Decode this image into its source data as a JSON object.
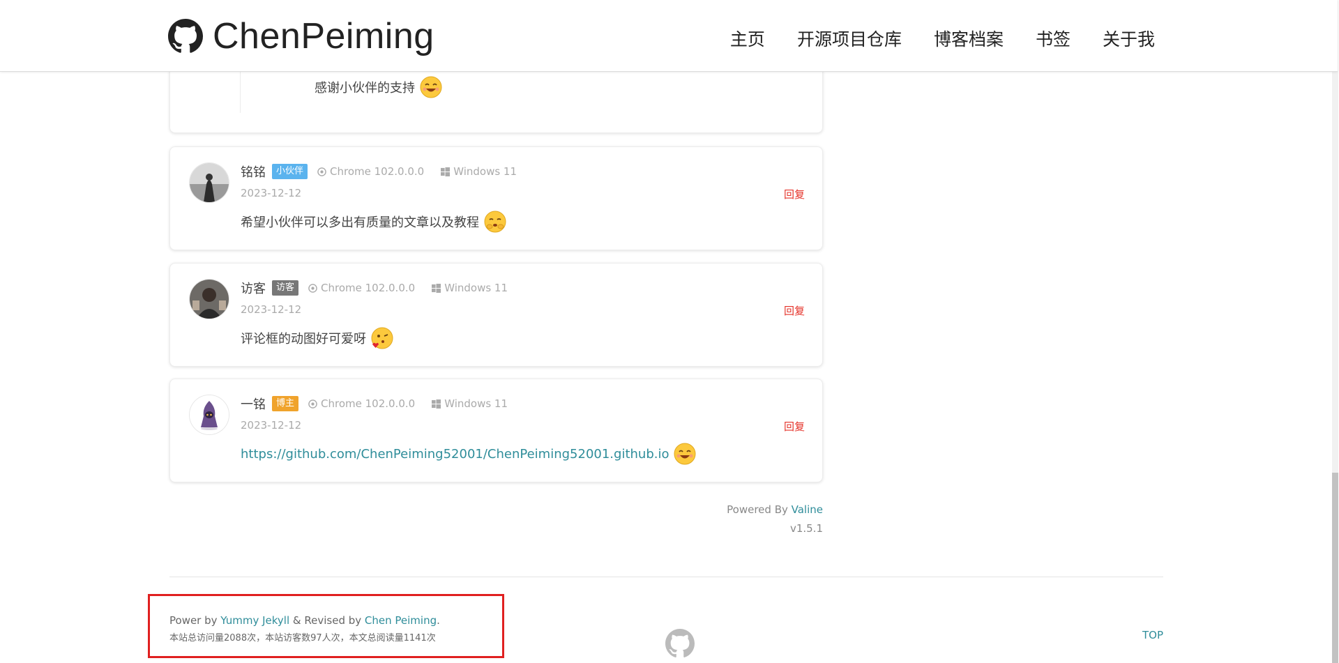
{
  "header": {
    "brand": "ChenPeiming",
    "nav": [
      "主页",
      "开源项目仓库",
      "博客档案",
      "书签",
      "关于我"
    ]
  },
  "top_card": {
    "content": "感谢小伙伴的支持"
  },
  "comments": [
    {
      "nick": "铭铭",
      "badge": "小伙伴",
      "badge_color": "#5ab3ee",
      "browser": "Chrome 102.0.0.0",
      "os": "Windows 11",
      "date": "2023-12-12",
      "reply": "回复",
      "content": "希望小伙伴可以多出有质量的文章以及教程"
    },
    {
      "nick": "访客",
      "badge": "访客",
      "badge_color": "#777777",
      "browser": "Chrome 102.0.0.0",
      "os": "Windows 11",
      "date": "2023-12-12",
      "reply": "回复",
      "content": "评论框的动图好可爱呀"
    },
    {
      "nick": "一铭",
      "badge": "博主",
      "badge_color": "#f0a32c",
      "browser": "Chrome 102.0.0.0",
      "os": "Windows 11",
      "date": "2023-12-12",
      "reply": "回复",
      "content": "https://github.com/ChenPeiming52001/ChenPeiming52001.github.io"
    }
  ],
  "powered": {
    "prefix": "Powered By ",
    "link": "Valine",
    "version": "v1.5.1"
  },
  "footer": {
    "power_prefix": "Power by ",
    "jekyll": "Yummy Jekyll",
    "revised": " & Revised by ",
    "author": "Chen Peiming",
    "period": ".",
    "stats": "本站总访问量2088次，本站访客数97人次，本文总阅读量1141次",
    "top": "TOP"
  },
  "colors": {
    "accent": "#2f8d9a",
    "reply": "#e5332a",
    "highlight_box": "#e02020"
  }
}
